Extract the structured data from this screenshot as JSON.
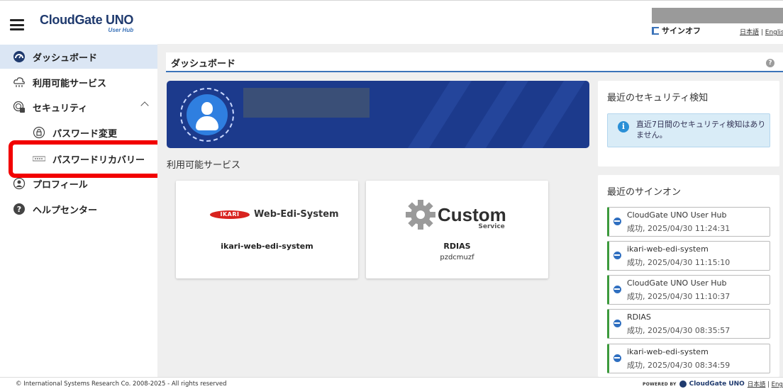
{
  "header": {
    "logo_main": "CloudGate UNO",
    "logo_sub": "User Hub",
    "signoff_label": "サインオフ",
    "lang_ja": "日本語",
    "lang_separator": " | ",
    "lang_en": "Englis"
  },
  "sidebar": {
    "items": [
      {
        "label": "ダッシュボード",
        "icon": "dashboard-icon",
        "active": true
      },
      {
        "label": "利用可能サービス",
        "icon": "cloud-services-icon"
      },
      {
        "label": "セキュリティ",
        "icon": "security-icon",
        "expanded": true
      },
      {
        "label": "パスワード変更",
        "icon": "lock-icon"
      },
      {
        "label": "パスワードリカバリー",
        "icon": "password-field-icon"
      },
      {
        "label": "プロフィール",
        "icon": "profile-icon"
      },
      {
        "label": "ヘルプセンター",
        "icon": "help-icon"
      }
    ]
  },
  "main": {
    "page_title": "ダッシュボード",
    "help_glyph": "?",
    "services_label": "利用可能サービス",
    "services": [
      {
        "logo_badge": "IKARI",
        "logo_text": "Web-Edi-System",
        "name": "ikari-web-edi-system",
        "sub": ""
      },
      {
        "logo_text": "Custom",
        "logo_sub": "Service",
        "name": "RDIAS",
        "sub": "pzdcmuzf"
      }
    ]
  },
  "security_panel": {
    "title": "最近のセキュリティ検知",
    "info_glyph": "i",
    "message": "直近7日間のセキュリティ検知はありません。"
  },
  "signon_panel": {
    "title": "最近のサインオン",
    "items": [
      {
        "name": "CloudGate UNO User Hub",
        "status": "成功, 2025/04/30 11:24:31"
      },
      {
        "name": "ikari-web-edi-system",
        "status": "成功, 2025/04/30 11:15:10"
      },
      {
        "name": "CloudGate UNO User Hub",
        "status": "成功, 2025/04/30 11:10:37"
      },
      {
        "name": "RDIAS",
        "status": "成功, 2025/04/30 08:35:57"
      },
      {
        "name": "ikari-web-edi-system",
        "status": "成功, 2025/04/30 08:34:59"
      }
    ]
  },
  "footer": {
    "copyright": "© International Systems Research Co.  2008-2025 - All rights reserved",
    "powered_by": "POWERED BY",
    "brand": "CloudGate UNO",
    "lang_ja": "日本語",
    "lang_separator": " | ",
    "lang_en": "Engli"
  },
  "colors": {
    "accent": "#3b73b9",
    "banner": "#1c3a8c",
    "active_nav": "#dbe6f4",
    "highlight": "#f20000",
    "success": "#3c9a3c"
  }
}
